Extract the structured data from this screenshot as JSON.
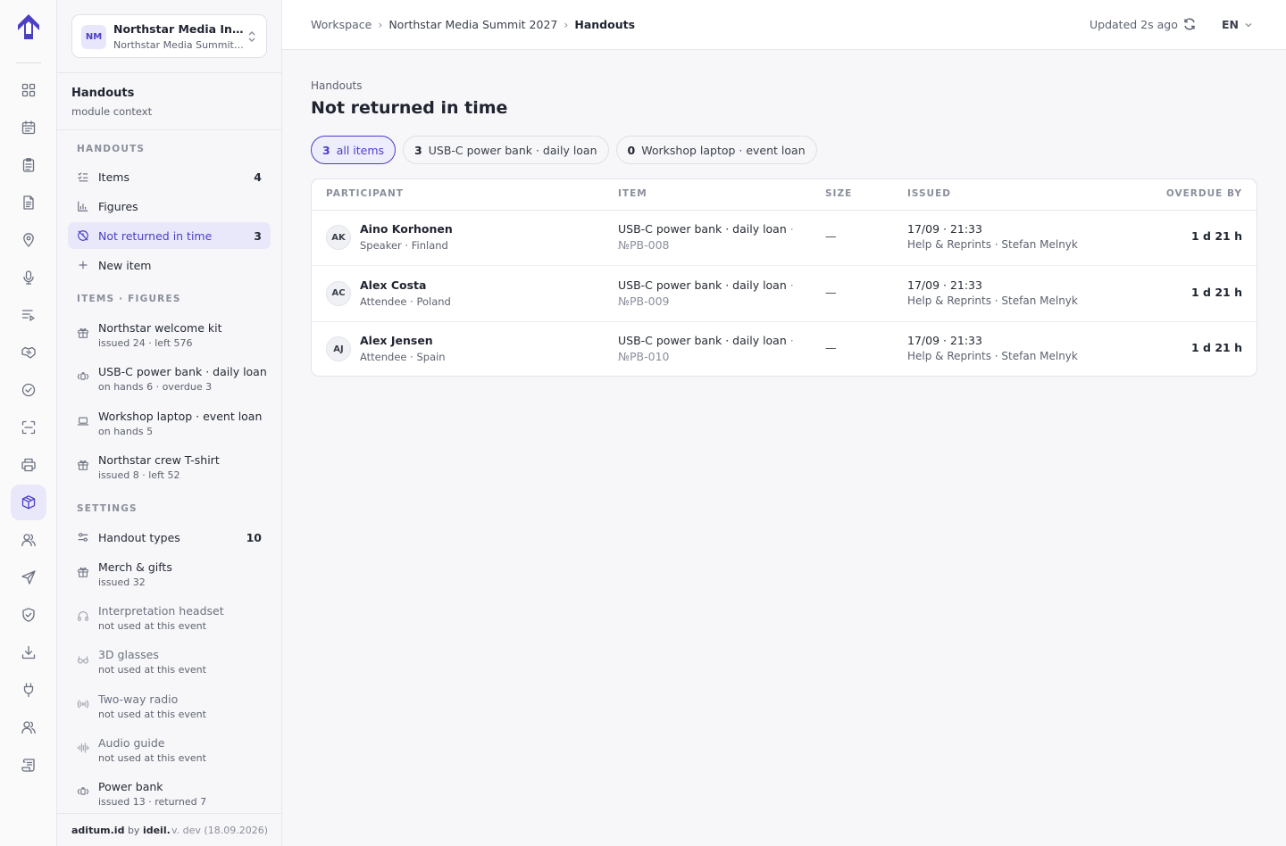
{
  "rail": {
    "items": [
      "dashboard-icon",
      "calendar-icon",
      "clipboard-icon",
      "document-icon",
      "location-icon",
      "microphone-icon",
      "playlist-icon",
      "handshake-icon",
      "check-circle-icon",
      "scan-icon",
      "printer-icon",
      "box-icon",
      "people-icon",
      "send-icon",
      "shield-icon",
      "download-icon",
      "plug-icon",
      "team-icon",
      "scroll-icon"
    ],
    "active": "box-icon"
  },
  "org": {
    "initials": "NM",
    "name": "Northstar Media Institute",
    "event": "Northstar Media Summit 2027"
  },
  "module": {
    "title": "Handouts",
    "subtitle": "module context"
  },
  "sidebar": {
    "handouts_label": "HANDOUTS",
    "nav": [
      {
        "label": "Items",
        "count": "4",
        "icon": "checklist-icon"
      },
      {
        "label": "Figures",
        "count": "",
        "icon": "bar-chart-icon"
      },
      {
        "label": "Not returned in time",
        "count": "3",
        "icon": "no-clock-icon"
      },
      {
        "label": "New item",
        "count": "",
        "icon": "plus-icon"
      }
    ],
    "figures_label": "ITEMS · FIGURES",
    "figures": [
      {
        "name": "Northstar welcome kit",
        "meta": "issued 24 · left 576",
        "icon": "gift-icon"
      },
      {
        "name": "USB-C power bank · daily loan",
        "meta": "on hands 6 · overdue 3",
        "icon": "battery-icon"
      },
      {
        "name": "Workshop laptop · event loan",
        "meta": "on hands 5",
        "icon": "laptop-icon"
      },
      {
        "name": "Northstar crew T-shirt",
        "meta": "issued 8 · left 52",
        "icon": "gift-icon"
      }
    ],
    "settings_label": "SETTINGS",
    "settings_nav": {
      "label": "Handout types",
      "count": "10",
      "icon": "sliders-icon"
    },
    "types": [
      {
        "name": "Merch & gifts",
        "meta": "issued 32",
        "icon": "gift-icon",
        "dim": false
      },
      {
        "name": "Interpretation headset",
        "meta": "not used at this event",
        "icon": "headset-icon",
        "dim": true
      },
      {
        "name": "3D glasses",
        "meta": "not used at this event",
        "icon": "glasses-icon",
        "dim": true
      },
      {
        "name": "Two-way radio",
        "meta": "not used at this event",
        "icon": "radio-icon",
        "dim": true
      },
      {
        "name": "Audio guide",
        "meta": "not used at this event",
        "icon": "audio-wave-icon",
        "dim": true
      },
      {
        "name": "Power bank",
        "meta": "issued 13 · returned 7",
        "icon": "battery-icon",
        "dim": false
      }
    ]
  },
  "footer": {
    "brand": "aditum.id",
    "by": "by",
    "company": "ideil.",
    "version": "v. dev (18.09.2026)"
  },
  "topbar": {
    "breadcrumb": [
      "Workspace",
      "Northstar Media Summit 2027",
      "Handouts"
    ],
    "updated": "Updated 2s ago",
    "lang": "EN"
  },
  "page": {
    "kicker": "Handouts",
    "title": "Not returned in time"
  },
  "filters": [
    {
      "count": "3",
      "label": "all items",
      "active": true
    },
    {
      "count": "3",
      "label": "USB-C power bank · daily loan",
      "active": false
    },
    {
      "count": "0",
      "label": "Workshop laptop · event loan",
      "active": false
    }
  ],
  "table": {
    "columns": [
      "PARTICIPANT",
      "ITEM",
      "SIZE",
      "ISSUED",
      "OVERDUE BY"
    ],
    "rows": [
      {
        "initials": "AK",
        "name": "Aino Korhonen",
        "role": "Speaker · Finland",
        "item": "USB-C power bank · daily loan",
        "number": "№PB-008",
        "size": "—",
        "issued_at": "17/09 · 21:33",
        "issued_by": "Help & Reprints · Stefan Melnyk",
        "overdue": "1 d 21 h"
      },
      {
        "initials": "AC",
        "name": "Alex Costa",
        "role": "Attendee · Poland",
        "item": "USB-C power bank · daily loan",
        "number": "№PB-009",
        "size": "—",
        "issued_at": "17/09 · 21:33",
        "issued_by": "Help & Reprints · Stefan Melnyk",
        "overdue": "1 d 21 h"
      },
      {
        "initials": "AJ",
        "name": "Alex Jensen",
        "role": "Attendee · Spain",
        "item": "USB-C power bank · daily loan",
        "number": "№PB-010",
        "size": "—",
        "issued_at": "17/09 · 21:33",
        "issued_by": "Help & Reprints · Stefan Melnyk",
        "overdue": "1 d 21 h"
      }
    ]
  },
  "colors": {
    "accent": "#4b3fc4",
    "accent_bg": "#e9e8fb",
    "border": "#e6e7ec"
  }
}
